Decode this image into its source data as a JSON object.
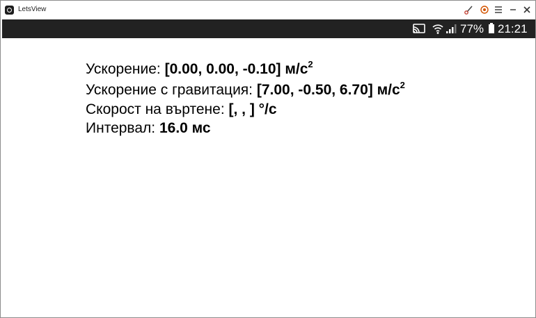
{
  "window": {
    "title": "LetsView",
    "controls": [
      "brush-icon",
      "record-icon",
      "menu-icon",
      "minimize-icon",
      "close-icon"
    ]
  },
  "status_bar": {
    "battery": "77%",
    "time": "21:21",
    "icons": [
      "cast-icon",
      "wifi-icon",
      "signal-icon",
      "battery-icon"
    ]
  },
  "readings": {
    "acceleration": {
      "label": "Ускорение: ",
      "value": "[0.00, 0.00, -0.10]",
      "unit": " м/с",
      "exp": "2"
    },
    "acceleration_gravity": {
      "label": "Ускорение с гравитация: ",
      "value": "[7.00, -0.50, 6.70]",
      "unit": " м/с",
      "exp": "2"
    },
    "rotation_speed": {
      "label": "Скорост на въртене: ",
      "value": "[, , ]",
      "unit": " °/с"
    },
    "interval": {
      "label": "Интервал: ",
      "value": "16.0 мс"
    }
  }
}
